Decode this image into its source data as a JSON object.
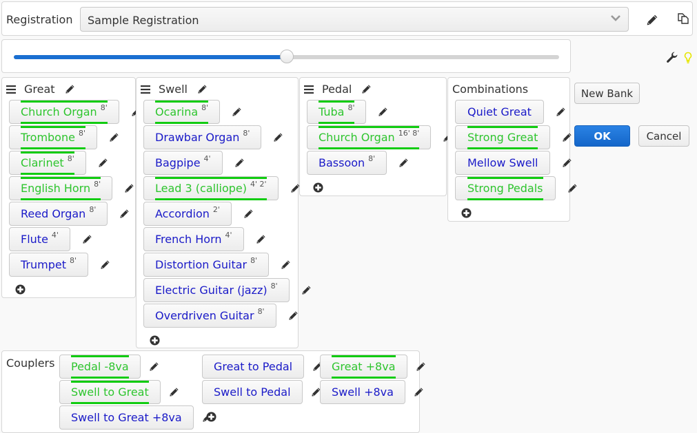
{
  "registration": {
    "label": "Registration",
    "selected": "Sample Registration",
    "icons": {
      "dropdown": "chevron-down-icon",
      "edit": "pencil-icon",
      "copy": "copy-icon"
    }
  },
  "slider": {
    "value_fraction": 0.5
  },
  "toolbar_icons": {
    "settings": "wrench-icon",
    "tip": "lightbulb-icon"
  },
  "colors": {
    "active_text": "#2ec52e",
    "active_line": "#11cc11",
    "inactive_text": "#1a1ac8",
    "primary": "#1a6fd1",
    "tip_bulb": "#e6e600"
  },
  "divisions": [
    {
      "name": "Great",
      "stops": [
        {
          "label": "Church Organ",
          "pitch": "8'",
          "active": true
        },
        {
          "label": "Trombone",
          "pitch": "8'",
          "active": true
        },
        {
          "label": "Clarinet",
          "pitch": "8'",
          "active": true
        },
        {
          "label": "English Horn",
          "pitch": "8'",
          "active": true
        },
        {
          "label": "Reed Organ",
          "pitch": "8'",
          "active": false
        },
        {
          "label": "Flute",
          "pitch": "4'",
          "active": false
        },
        {
          "label": "Trumpet",
          "pitch": "8'",
          "active": false
        }
      ]
    },
    {
      "name": "Swell",
      "stops": [
        {
          "label": "Ocarina",
          "pitch": "8'",
          "active": true
        },
        {
          "label": "Drawbar Organ",
          "pitch": "8'",
          "active": false
        },
        {
          "label": "Bagpipe",
          "pitch": "4'",
          "active": false
        },
        {
          "label": "Lead 3 (calliope)",
          "pitch": "4' 2'",
          "active": true
        },
        {
          "label": "Accordion",
          "pitch": "2'",
          "active": false
        },
        {
          "label": "French Horn",
          "pitch": "4'",
          "active": false
        },
        {
          "label": "Distortion Guitar",
          "pitch": "8'",
          "active": false
        },
        {
          "label": "Electric Guitar (jazz)",
          "pitch": "8'",
          "active": false
        },
        {
          "label": "Overdriven Guitar",
          "pitch": "8'",
          "active": false
        }
      ]
    },
    {
      "name": "Pedal",
      "stops": [
        {
          "label": "Tuba",
          "pitch": "8'",
          "active": true
        },
        {
          "label": "Church Organ",
          "pitch": "16' 8'",
          "active": true
        },
        {
          "label": "Bassoon",
          "pitch": "8'",
          "active": false
        }
      ]
    }
  ],
  "combinations": {
    "title": "Combinations",
    "items": [
      {
        "label": "Quiet Great",
        "active": false
      },
      {
        "label": "Strong Great",
        "active": true
      },
      {
        "label": "Mellow Swell",
        "active": false
      },
      {
        "label": "Strong Pedals",
        "active": true
      }
    ]
  },
  "buttons": {
    "new_bank": "New Bank",
    "ok": "OK",
    "cancel": "Cancel"
  },
  "couplers": {
    "title": "Couplers",
    "items": [
      {
        "label": "Pedal -8va",
        "active": true
      },
      {
        "label": "Great to Pedal",
        "active": false
      },
      {
        "label": "Great +8va",
        "active": true
      },
      {
        "label": "Swell to Great",
        "active": true
      },
      {
        "label": "Swell to Pedal",
        "active": false
      },
      {
        "label": "Swell +8va",
        "active": false
      },
      {
        "label": "Swell to Great +8va",
        "active": false
      }
    ]
  }
}
